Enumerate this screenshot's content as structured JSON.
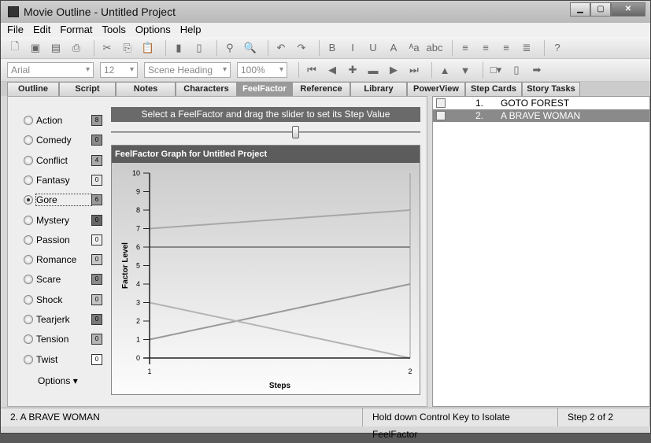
{
  "window": {
    "title": "Movie Outline - Untitled Project",
    "min": "▁",
    "max": "▢",
    "close": "✕"
  },
  "menu": [
    "File",
    "Edit",
    "Format",
    "Tools",
    "Options",
    "Help"
  ],
  "toolbar1": [
    [
      "new-icon",
      "🗋"
    ],
    [
      "open-icon",
      "▣"
    ],
    [
      "save-icon",
      "▤"
    ],
    [
      "print-icon",
      "⎙"
    ],
    [
      "sep"
    ],
    [
      "cut-icon",
      "✂"
    ],
    [
      "copy-icon",
      "⎘"
    ],
    [
      "paste-icon",
      "📋"
    ],
    [
      "sep"
    ],
    [
      "notebook-icon",
      "▮"
    ],
    [
      "book-icon",
      "▯"
    ],
    [
      "sep"
    ],
    [
      "find-icon",
      "⚲"
    ],
    [
      "zoom-icon",
      "🔍"
    ],
    [
      "sep"
    ],
    [
      "undo-icon",
      "↶"
    ],
    [
      "redo-icon",
      "↷"
    ],
    [
      "sep"
    ],
    [
      "bold-icon",
      "B"
    ],
    [
      "italic-icon",
      "I"
    ],
    [
      "underline-icon",
      "U"
    ],
    [
      "font-color-icon",
      "A"
    ],
    [
      "case-icon",
      "ᴬa"
    ],
    [
      "strikethrough-icon",
      "abc"
    ],
    [
      "sep"
    ],
    [
      "align-left-icon",
      "≡"
    ],
    [
      "align-center-icon",
      "≡"
    ],
    [
      "align-right-icon",
      "≡"
    ],
    [
      "justify-icon",
      "≣"
    ],
    [
      "sep"
    ],
    [
      "help-icon",
      "?"
    ]
  ],
  "toolbar2": {
    "font": "Arial",
    "size": "12",
    "element": "Scene Heading",
    "zoom": "100%",
    "buttons": [
      [
        "first-icon",
        "⏮"
      ],
      [
        "prev-icon",
        "◀"
      ],
      [
        "add-icon",
        "✚"
      ],
      [
        "remove-icon",
        "▬"
      ],
      [
        "next-icon",
        "▶"
      ],
      [
        "last-icon",
        "⏭"
      ],
      [
        "sep"
      ],
      [
        "move-up-icon",
        "▲"
      ],
      [
        "move-down-icon",
        "▼"
      ],
      [
        "sep"
      ],
      [
        "color-picker-icon",
        "□▾"
      ],
      [
        "page-icon",
        "▯"
      ],
      [
        "export-icon",
        "➡"
      ]
    ]
  },
  "tabs": [
    "Outline",
    "Script",
    "Notes",
    "Characters",
    "FeelFactor",
    "Reference",
    "Library",
    "PowerView",
    "Step Cards",
    "Story Tasks"
  ],
  "active_tab": "FeelFactor",
  "feelfactors": [
    {
      "name": "Action",
      "value": "8",
      "shade": "#9a9a9a"
    },
    {
      "name": "Comedy",
      "value": "0",
      "shade": "#8a8a8a"
    },
    {
      "name": "Conflict",
      "value": "4",
      "shade": "#aaaaaa"
    },
    {
      "name": "Fantasy",
      "value": "0",
      "shade": "#e8e8e8"
    },
    {
      "name": "Gore",
      "value": "6",
      "shade": "#999999",
      "selected": true
    },
    {
      "name": "Mystery",
      "value": "0",
      "shade": "#666666"
    },
    {
      "name": "Passion",
      "value": "0",
      "shade": "#f0f0f0"
    },
    {
      "name": "Romance",
      "value": "0",
      "shade": "#c8c8c8"
    },
    {
      "name": "Scare",
      "value": "0",
      "shade": "#8a8a8a"
    },
    {
      "name": "Shock",
      "value": "0",
      "shade": "#c4c4c4"
    },
    {
      "name": "Tearjerk",
      "value": "0",
      "shade": "#7a7a7a"
    },
    {
      "name": "Tension",
      "value": "0",
      "shade": "#b4b4b4"
    },
    {
      "name": "Twist",
      "value": "0",
      "shade": "#ffffff"
    }
  ],
  "options_label": "Options ▾",
  "instruction": "Select a FeelFactor and drag the slider to set its Step Value",
  "slider_value": 6,
  "chart_data": {
    "type": "line",
    "title": "FeelFactor Graph for Untitled Project",
    "xlabel": "Steps",
    "ylabel": "Factor Level",
    "x": [
      1,
      2
    ],
    "ylim": [
      0,
      10
    ],
    "yticks": [
      "0",
      "1",
      "2",
      "3",
      "4",
      "5",
      "6",
      "7",
      "8",
      "9",
      "10"
    ],
    "xticks": [
      "1",
      "2"
    ],
    "series": [
      {
        "values": [
          7,
          8
        ],
        "color": "#a8a8a8"
      },
      {
        "values": [
          6,
          6
        ],
        "color": "#888888"
      },
      {
        "values": [
          1,
          4
        ],
        "color": "#999999"
      },
      {
        "values": [
          3,
          0
        ],
        "color": "#b4b4b4"
      }
    ]
  },
  "steps": [
    {
      "num": "1.",
      "title": "GOTO FOREST"
    },
    {
      "num": "2.",
      "title": "A BRAVE WOMAN",
      "selected": true
    }
  ],
  "status": {
    "current": "2. A BRAVE WOMAN",
    "hint": "Hold down Control Key to Isolate FeelFactor",
    "step": "Step 2 of 2"
  }
}
